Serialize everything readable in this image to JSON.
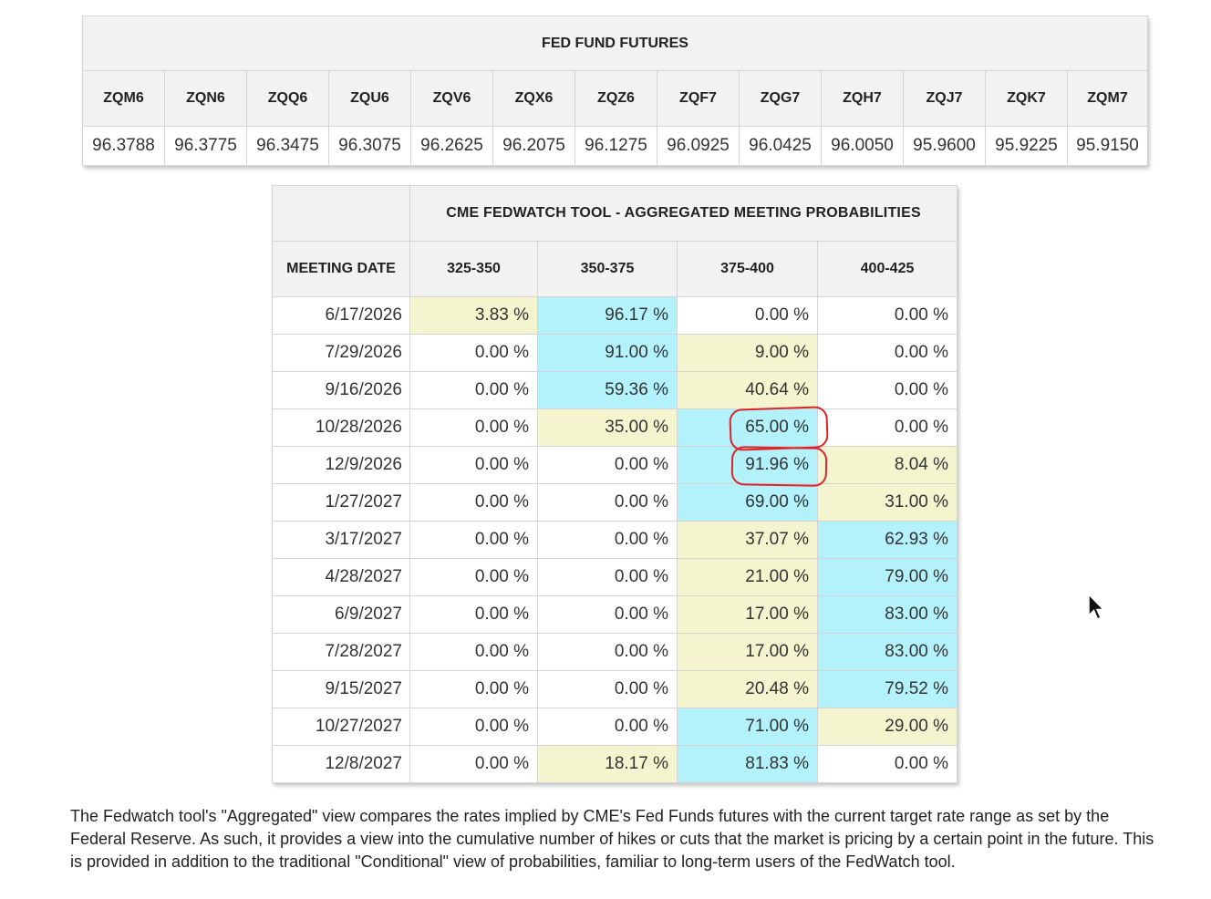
{
  "futures": {
    "title": "FED FUND FUTURES",
    "contracts": [
      {
        "symbol": "ZQM6",
        "price": "96.3788"
      },
      {
        "symbol": "ZQN6",
        "price": "96.3775"
      },
      {
        "symbol": "ZQQ6",
        "price": "96.3475"
      },
      {
        "symbol": "ZQU6",
        "price": "96.3075"
      },
      {
        "symbol": "ZQV6",
        "price": "96.2625"
      },
      {
        "symbol": "ZQX6",
        "price": "96.2075"
      },
      {
        "symbol": "ZQZ6",
        "price": "96.1275"
      },
      {
        "symbol": "ZQF7",
        "price": "96.0925"
      },
      {
        "symbol": "ZQG7",
        "price": "96.0425"
      },
      {
        "symbol": "ZQH7",
        "price": "96.0050"
      },
      {
        "symbol": "ZQJ7",
        "price": "95.9600"
      },
      {
        "symbol": "ZQK7",
        "price": "95.9225"
      },
      {
        "symbol": "ZQM7",
        "price": "95.9150"
      }
    ]
  },
  "probabilities": {
    "title": "CME FEDWATCH TOOL - AGGREGATED MEETING PROBABILITIES",
    "date_header": "MEETING DATE",
    "ranges": [
      "325-350",
      "350-375",
      "375-400",
      "400-425"
    ],
    "highlight_colors": {
      "low": "#f4f5cf",
      "high": "#b3f1fb",
      "annotation": "#d9262b"
    },
    "rows": [
      {
        "date": "6/17/2026",
        "values": [
          "3.83 %",
          "96.17 %",
          "0.00 %",
          "0.00 %"
        ],
        "shade": [
          "y",
          "b",
          "",
          ""
        ]
      },
      {
        "date": "7/29/2026",
        "values": [
          "0.00 %",
          "91.00 %",
          "9.00 %",
          "0.00 %"
        ],
        "shade": [
          "",
          "b",
          "y",
          ""
        ]
      },
      {
        "date": "9/16/2026",
        "values": [
          "0.00 %",
          "59.36 %",
          "40.64 %",
          "0.00 %"
        ],
        "shade": [
          "",
          "b",
          "y",
          ""
        ]
      },
      {
        "date": "10/28/2026",
        "values": [
          "0.00 %",
          "35.00 %",
          "65.00 %",
          "0.00 %"
        ],
        "shade": [
          "",
          "y",
          "b",
          ""
        ]
      },
      {
        "date": "12/9/2026",
        "values": [
          "0.00 %",
          "0.00 %",
          "91.96 %",
          "8.04 %"
        ],
        "shade": [
          "",
          "",
          "b",
          "y"
        ]
      },
      {
        "date": "1/27/2027",
        "values": [
          "0.00 %",
          "0.00 %",
          "69.00 %",
          "31.00 %"
        ],
        "shade": [
          "",
          "",
          "b",
          "y"
        ]
      },
      {
        "date": "3/17/2027",
        "values": [
          "0.00 %",
          "0.00 %",
          "37.07 %",
          "62.93 %"
        ],
        "shade": [
          "",
          "",
          "y",
          "b"
        ]
      },
      {
        "date": "4/28/2027",
        "values": [
          "0.00 %",
          "0.00 %",
          "21.00 %",
          "79.00 %"
        ],
        "shade": [
          "",
          "",
          "y",
          "b"
        ]
      },
      {
        "date": "6/9/2027",
        "values": [
          "0.00 %",
          "0.00 %",
          "17.00 %",
          "83.00 %"
        ],
        "shade": [
          "",
          "",
          "y",
          "b"
        ]
      },
      {
        "date": "7/28/2027",
        "values": [
          "0.00 %",
          "0.00 %",
          "17.00 %",
          "83.00 %"
        ],
        "shade": [
          "",
          "",
          "y",
          "b"
        ]
      },
      {
        "date": "9/15/2027",
        "values": [
          "0.00 %",
          "0.00 %",
          "20.48 %",
          "79.52 %"
        ],
        "shade": [
          "",
          "",
          "y",
          "b"
        ]
      },
      {
        "date": "10/27/2027",
        "values": [
          "0.00 %",
          "0.00 %",
          "71.00 %",
          "29.00 %"
        ],
        "shade": [
          "",
          "",
          "b",
          "y"
        ]
      },
      {
        "date": "12/8/2027",
        "values": [
          "0.00 %",
          "18.17 %",
          "81.83 %",
          "0.00 %"
        ],
        "shade": [
          "",
          "y",
          "b",
          ""
        ]
      }
    ]
  },
  "cursor_icon": "mouse-pointer-icon",
  "footnote": "The Fedwatch tool's \"Aggregated\" view compares the rates implied by CME's Fed Funds futures with the current target rate range as set by the Federal Reserve. As such, it provides a view into the cumulative number of hikes or cuts that the market is pricing by a certain point in the future. This is provided in addition to the traditional \"Conditional\" view of probabilities, familiar to long-term users of the FedWatch tool."
}
